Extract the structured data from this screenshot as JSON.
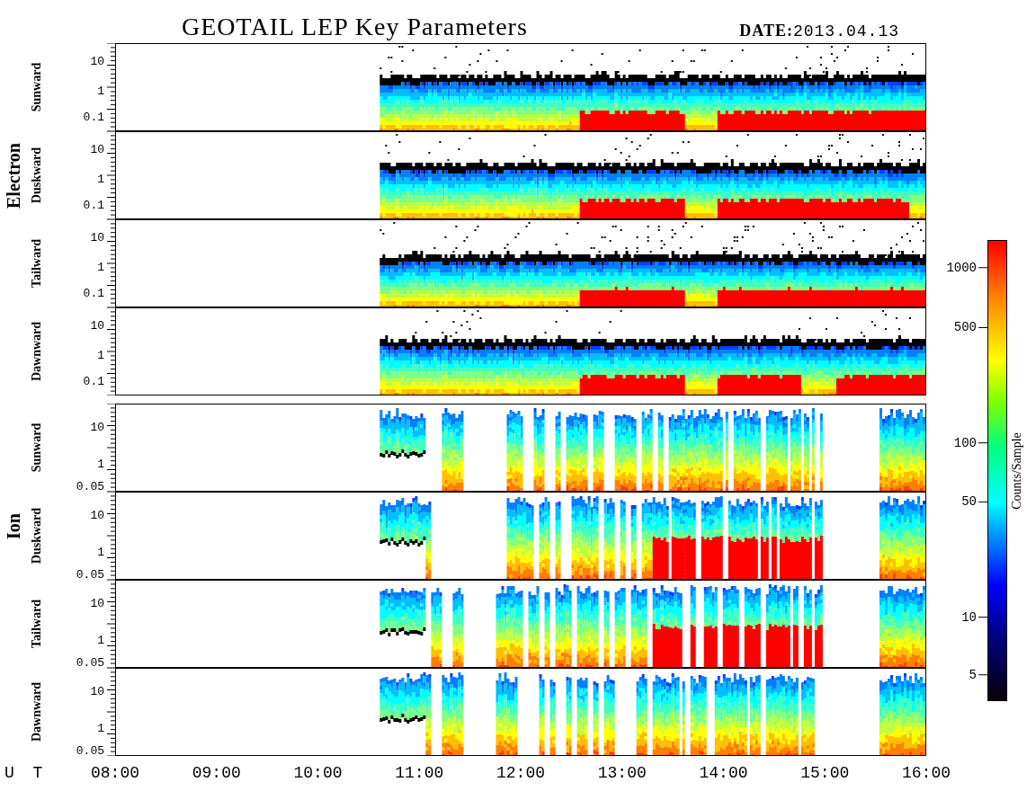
{
  "title": "GEOTAIL LEP Key Parameters",
  "date": "**DATE:**2013.04.13",
  "groups": [
    {
      "label": "Electron",
      "kind": "electron",
      "panels": [
        {
          "label": "Sunward",
          "ticks": [
            "10",
            "1",
            "0.1"
          ]
        },
        {
          "label": "Duskward",
          "ticks": [
            "10",
            "1",
            "0.1"
          ]
        },
        {
          "label": "Tailward",
          "ticks": [
            "10",
            "1",
            "0.1"
          ]
        },
        {
          "label": "Dawnward",
          "ticks": [
            "10",
            "1",
            "0.1"
          ]
        }
      ]
    },
    {
      "label": "Ion",
      "kind": "ion",
      "panels": [
        {
          "label": "Sunward",
          "ticks": [
            "10",
            "1",
            "0.05"
          ]
        },
        {
          "label": "Duskward",
          "ticks": [
            "10",
            "1",
            "0.05"
          ]
        },
        {
          "label": "Tailward",
          "ticks": [
            "10",
            "1",
            "0.05"
          ]
        },
        {
          "label": "Dawnward",
          "ticks": [
            "10",
            "1",
            "0.05"
          ]
        }
      ]
    }
  ],
  "colorbar": {
    "label": "Counts/Sample",
    "ticks": [
      "1000",
      "500",
      "100",
      "50",
      "10",
      "5"
    ]
  },
  "x_axis": {
    "label": "U T",
    "ticks": [
      "08:00",
      "09:00",
      "10:00",
      "11:00",
      "12:00",
      "13:00",
      "14:00",
      "15:00",
      "16:00"
    ]
  }
}
